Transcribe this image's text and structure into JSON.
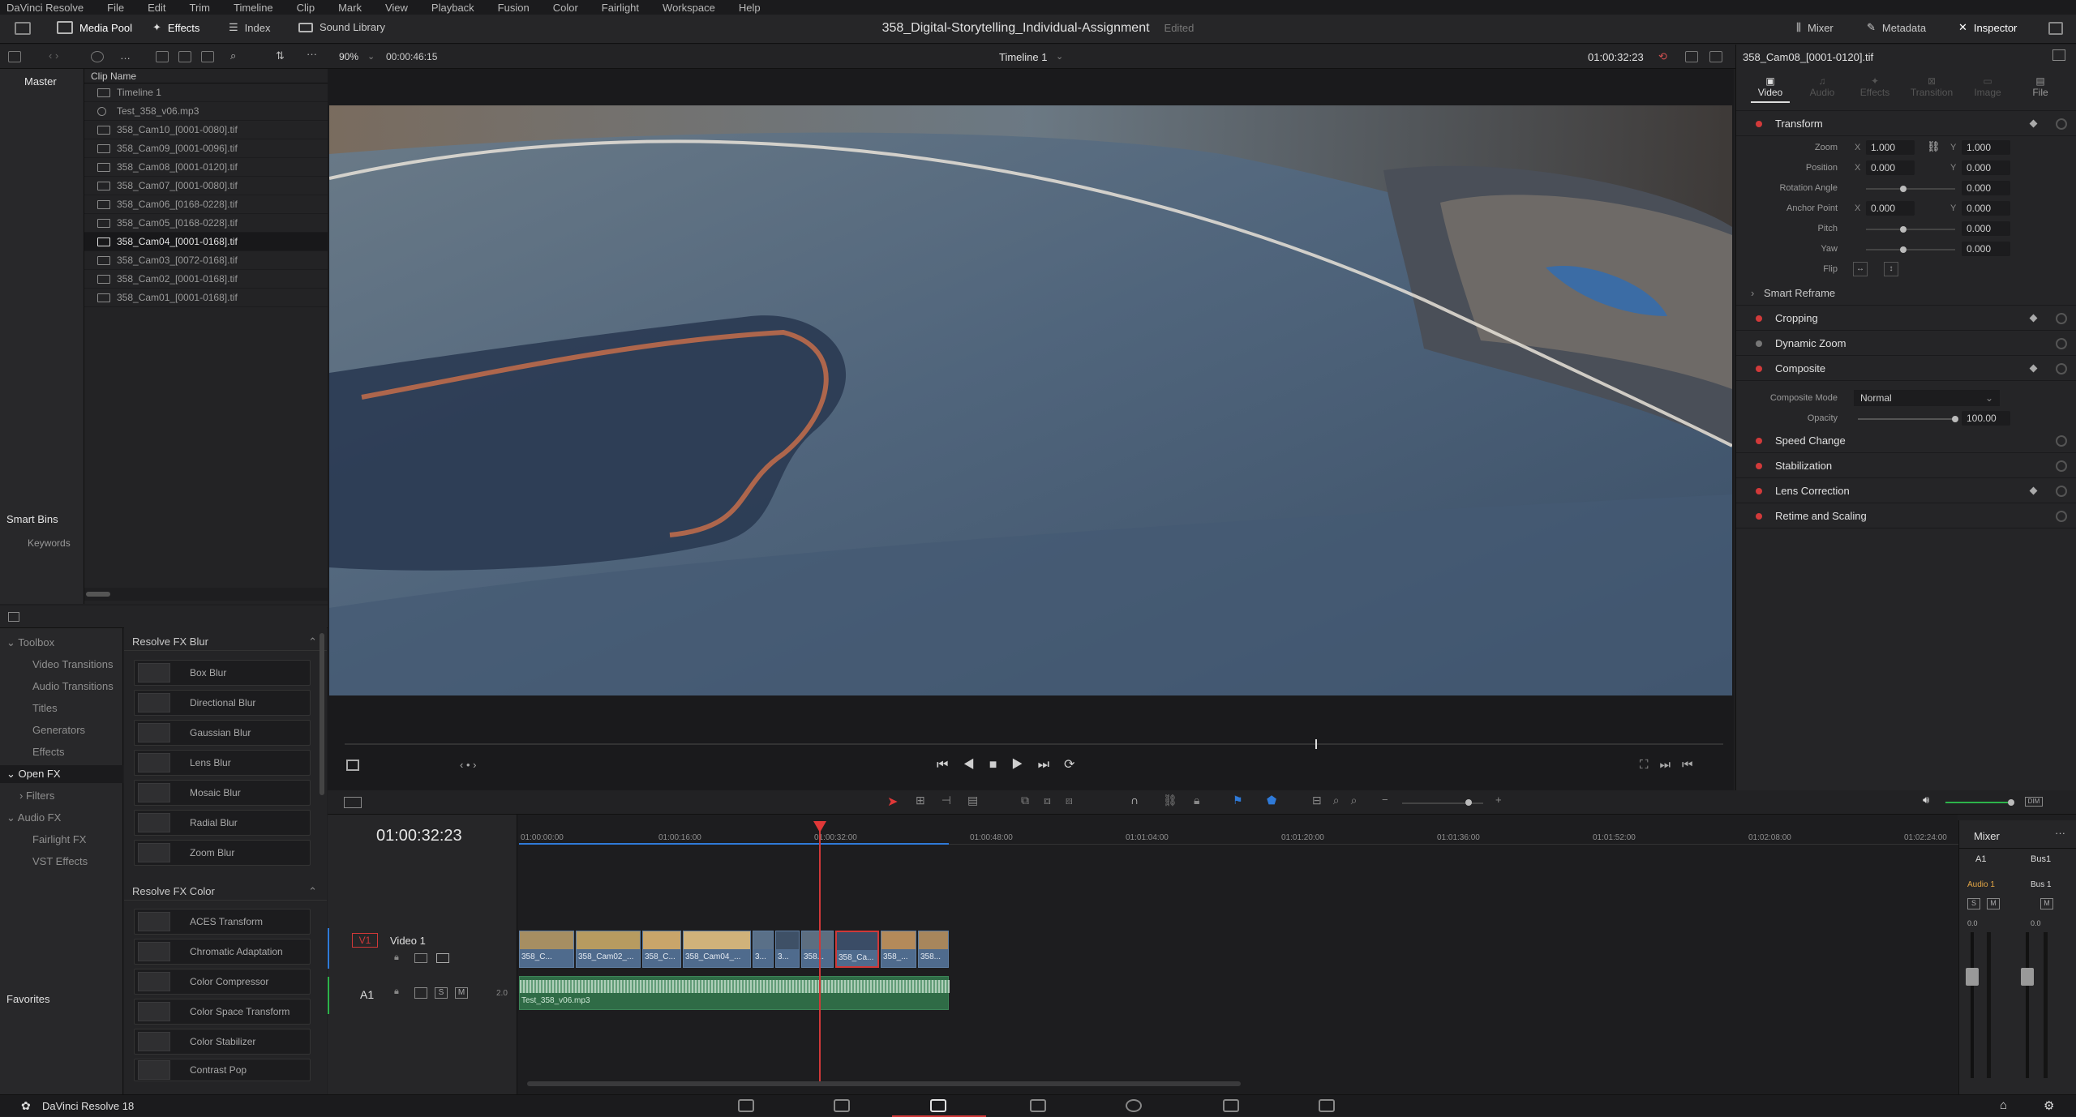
{
  "menu": [
    "DaVinci Resolve",
    "File",
    "Edit",
    "Trim",
    "Timeline",
    "Clip",
    "Mark",
    "View",
    "Playback",
    "Fusion",
    "Color",
    "Fairlight",
    "Workspace",
    "Help"
  ],
  "toolbar": {
    "media_pool": "Media Pool",
    "effects": "Effects",
    "index": "Index",
    "sound_library": "Sound Library",
    "mixer": "Mixer",
    "metadata": "Metadata",
    "inspector": "Inspector"
  },
  "project": {
    "title": "358_Digital-Storytelling_Individual-Assignment",
    "status": "Edited"
  },
  "viewer": {
    "zoom": "90%",
    "duration": "00:00:46:15",
    "timeline_name": "Timeline 1",
    "timecode": "01:00:32:23"
  },
  "bins": {
    "master": "Master",
    "smart_bins": "Smart Bins",
    "keywords": "Keywords"
  },
  "pool": {
    "header": "Clip Name",
    "clips": [
      "Timeline 1",
      "Test_358_v06.mp3",
      "358_Cam10_[0001-0080].tif",
      "358_Cam09_[0001-0096].tif",
      "358_Cam08_[0001-0120].tif",
      "358_Cam07_[0001-0080].tif",
      "358_Cam06_[0168-0228].tif",
      "358_Cam05_[0168-0228].tif",
      "358_Cam04_[0001-0168].tif",
      "358_Cam03_[0072-0168].tif",
      "358_Cam02_[0001-0168].tif",
      "358_Cam01_[0001-0168].tif"
    ]
  },
  "inspector": {
    "clip": "358_Cam08_[0001-0120].tif",
    "tabs": [
      "Video",
      "Audio",
      "Effects",
      "Transition",
      "Image",
      "File"
    ],
    "transform": "Transform",
    "params": [
      {
        "label": "Zoom",
        "x": "1.000",
        "y": "1.000"
      },
      {
        "label": "Position",
        "x": "0.000",
        "y": "0.000"
      },
      {
        "label": "Rotation Angle",
        "v": "0.000"
      },
      {
        "label": "Anchor Point",
        "x": "0.000",
        "y": "0.000"
      },
      {
        "label": "Pitch",
        "v": "0.000"
      },
      {
        "label": "Yaw",
        "v": "0.000"
      },
      {
        "label": "Flip"
      }
    ],
    "smart_reframe": "Smart Reframe",
    "cropping": "Cropping",
    "dynamic_zoom": "Dynamic Zoom",
    "composite": "Composite",
    "composite_mode_label": "Composite Mode",
    "composite_mode": "Normal",
    "opacity_label": "Opacity",
    "opacity": "100.00",
    "speed_change": "Speed Change",
    "stabilization": "Stabilization",
    "lens_correction": "Lens Correction",
    "retime": "Retime and Scaling",
    "x_axis": "X",
    "y_axis": "Y"
  },
  "fxnav": {
    "toolbox": "Toolbox",
    "video_transitions": "Video Transitions",
    "audio_transitions": "Audio Transitions",
    "titles": "Titles",
    "generators": "Generators",
    "effects": "Effects",
    "open_fx": "Open FX",
    "filters": "Filters",
    "audio_fx": "Audio FX",
    "fairlight_fx": "Fairlight FX",
    "vst_effects": "VST Effects",
    "favorites": "Favorites"
  },
  "fxlist": {
    "blur_header": "Resolve FX Blur",
    "blur": [
      "Box Blur",
      "Directional Blur",
      "Gaussian Blur",
      "Lens Blur",
      "Mosaic Blur",
      "Radial Blur",
      "Zoom Blur"
    ],
    "color_header": "Resolve FX Color",
    "color": [
      "ACES Transform",
      "Chromatic Adaptation",
      "Color Compressor",
      "Color Space Transform",
      "Color Stabilizer",
      "Contrast Pop"
    ]
  },
  "timeline": {
    "timecode": "01:00:32:23",
    "ruler": [
      "01:00:00:00",
      "01:00:16:00",
      "01:00:32:00",
      "01:00:48:00",
      "01:01:04:00",
      "01:01:20:00",
      "01:01:36:00",
      "01:01:52:00",
      "01:02:08:00",
      "01:02:24:00"
    ],
    "v1": "V1",
    "video1": "Video 1",
    "a1": "A1",
    "a1_level": "2.0",
    "s": "S",
    "m": "M",
    "video_clips": [
      "358_C...",
      "358_Cam02_...",
      "358_C...",
      "358_Cam04_...",
      "3...",
      "3...",
      "358...",
      "358_Ca...",
      "358_...",
      "358..."
    ],
    "audio_clip": "Test_358_v06.mp3"
  },
  "mixer": {
    "title": "Mixer",
    "ch1": "A1",
    "ch2": "Bus1",
    "ch1_bus": "Audio 1",
    "ch2_bus": "Bus 1",
    "s": "S",
    "m": "M",
    "v1": "0.0",
    "v2": "0.0"
  },
  "footer": {
    "app": "DaVinci Resolve 18"
  }
}
